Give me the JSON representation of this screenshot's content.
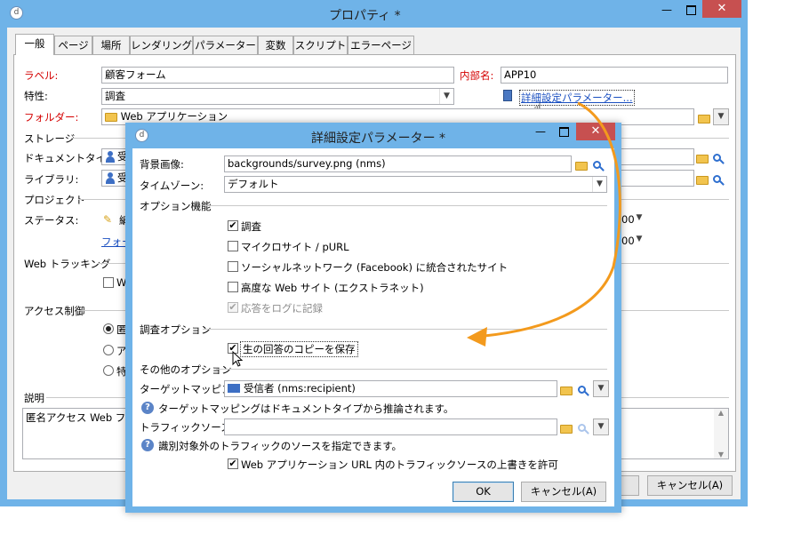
{
  "main_window": {
    "title": "プロパティ *",
    "tabs": [
      "一般",
      "ページ",
      "場所",
      "レンダリング",
      "パラメーター",
      "変数",
      "スクリプト",
      "エラーページ"
    ],
    "label_label": "ラベル:",
    "label_value": "顧客フォーム",
    "internal_name_label": "内部名:",
    "internal_name_value": "APP10",
    "property_label": "特性:",
    "property_value": "調査",
    "advanced_link": "詳細設定パラメーター...",
    "folder_label": "フォルダー:",
    "folder_value": "Web アプリケーション",
    "storage_section": "ストレージ",
    "doc_type_label": "ドキュメントタイプ:",
    "doc_type_value": "受",
    "library_label": "ライブラリ:",
    "library_value": "受",
    "project_section": "プロジェクト",
    "status_label": "ステータス:",
    "status_value": "編",
    "form_link": "フォー",
    "status_combo_1": "00",
    "status_combo_2": "00",
    "web_tracking_section": "Web トラッキング",
    "web_tracking_check": "W",
    "access_section": "アクセス制御",
    "radio_1": "匿",
    "radio_2": "ア",
    "radio_3": "特",
    "description_section": "説明",
    "description_value": "匿名アクセス Web フォー",
    "cancel_button": "キャンセル(A)"
  },
  "dialog": {
    "title": "詳細設定パラメーター *",
    "bg_image_label": "背景画像:",
    "bg_image_value": "backgrounds/survey.png (nms)",
    "timezone_label": "タイムゾーン:",
    "timezone_value": "デフォルト",
    "options_section": "オプション機能",
    "opt_survey": "調査",
    "opt_microsite": "マイクロサイト / pURL",
    "opt_social": "ソーシャルネットワーク (Facebook) に統合されたサイト",
    "opt_advanced_web": "高度な Web サイト (エクストラネット)",
    "opt_log": "応答をログに記録",
    "survey_options_section": "調査オプション",
    "opt_save_raw": "生の回答のコピーを保存",
    "other_options_section": "その他のオプション",
    "target_mapping_label": "ターゲットマッピング:",
    "target_mapping_value": "受信者 (nms:recipient)",
    "target_mapping_help": "ターゲットマッピングはドキュメントタイプから推論されます。",
    "traffic_source_label": "トラフィックソース:",
    "traffic_source_value": "",
    "traffic_source_help": "識別対象外のトラフィックのソースを指定できます。",
    "opt_override_traffic": "Web アプリケーション URL 内のトラフィックソースの上書きを許可",
    "ok_button": "OK",
    "cancel_button": "キャンセル(A)"
  },
  "checks": {
    "opt_survey": true,
    "opt_microsite": false,
    "opt_social": false,
    "opt_advanced_web": false,
    "opt_log": true,
    "opt_save_raw": true,
    "opt_override_traffic": true
  },
  "icons": [
    "app-icon",
    "minimize-icon",
    "maximize-icon",
    "close-icon",
    "folder-icon",
    "search-icon",
    "person-icon",
    "help-icon",
    "clipboard-icon",
    "pencil-icon",
    "hand-cursor-icon",
    "arrow-cursor-icon",
    "envelope-icon"
  ],
  "colors": {
    "accent_orange": "#f39a1d",
    "close_red": "#c75050",
    "label_red": "#d40000",
    "link_blue": "#1a4fc0"
  }
}
